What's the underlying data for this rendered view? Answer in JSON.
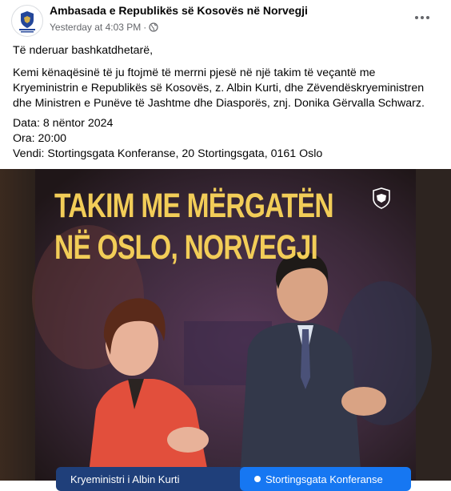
{
  "post": {
    "page_name": "Ambasada e Republikës së Kosovës në Norvegji",
    "timestamp": "Yesterday at 4:03 PM",
    "separator": "·",
    "audience_icon": "globe-icon",
    "more_icon": "more-options-icon"
  },
  "body": {
    "greeting": "Të nderuar bashkatdhetarë,",
    "paragraph": "Kemi kënaqësinë të ju ftojmë të merrni pjesë në një takim të veçantë me Kryeministrin e Republikës së Kosovës, z. Albin Kurti, dhe Zëvendëskryeministren dhe Ministren e Punëve të Jashtme dhe Diasporës, znj. Donika Gërvalla Schwarz.",
    "date": "Data: 8 nëntor 2024",
    "time": "Ora: 20:00",
    "venue": "Vendi: Stortingsgata Konferanse, 20 Stortingsgata, 0161 Oslo"
  },
  "image": {
    "headline_line1": "TAKIM ME MËRGATËN",
    "headline_line2": "NË OSLO, NORVEGJI",
    "bottom_left": "Kryeministri i Albin Kurti",
    "bottom_right": "Stortingsgata Konferanse",
    "colors": {
      "headline": "#f2cd58",
      "background": "#2a1f1a",
      "pill_dark": "#1f3f7a",
      "pill_blue": "#1677f2"
    }
  }
}
